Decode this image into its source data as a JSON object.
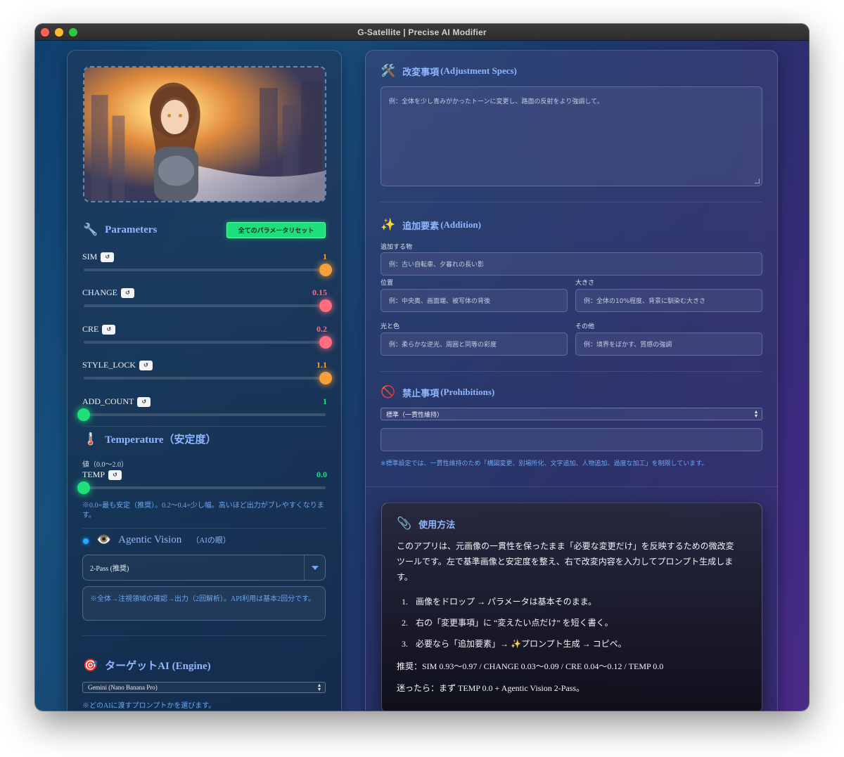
{
  "window": {
    "title": "G-Satellite | Precise AI Modifier"
  },
  "left": {
    "parameters": {
      "icon": "🔧",
      "title": "Parameters",
      "reset_all_label": "全てのパラメータリセット",
      "sliders": [
        {
          "name": "SIM",
          "value": "1",
          "fraction": 1.0,
          "color": "#f7a03a"
        },
        {
          "name": "CHANGE",
          "value": "0.15",
          "fraction": 1.0,
          "color": "#ff6b7f"
        },
        {
          "name": "CRE",
          "value": "0.2",
          "fraction": 1.0,
          "color": "#ff6b7f"
        },
        {
          "name": "STYLE_LOCK",
          "value": "1.1",
          "fraction": 1.0,
          "color": "#f7a03a"
        },
        {
          "name": "ADD_COUNT",
          "value": "1",
          "fraction": 0.0,
          "color": "#1ee07a"
        }
      ],
      "reset_glyph": "↺"
    },
    "temperature": {
      "icon": "🌡️",
      "title": "Temperature（安定度）",
      "range_label": "値（0.0〜2.0）",
      "slider": {
        "name": "TEMP",
        "value": "0.0",
        "fraction": 0.0,
        "color": "#1ee07a"
      },
      "note": "※0.0=最も安定（推奨）。0.2〜0.4=少し幅。高いほど出力がブレやすくなります。"
    },
    "agentic_vision": {
      "icon": "👁️",
      "title": "Agentic Vision",
      "subtitle": "（AIの眼）",
      "selected": "2-Pass (推奨)",
      "hint": "※全体→注視領域の確認→出力（2回解析）。API利用は基本2回分です。"
    },
    "target_ai": {
      "icon": "🎯",
      "title": "ターゲットAI (Engine)",
      "selected": "Gemini (Nano Banana Pro)",
      "note": "※どのAIに渡すプロンプトかを選びます。"
    }
  },
  "right": {
    "adjustment": {
      "icon": "🛠️",
      "title": "改変事項",
      "subtitle": "(Adjustment Specs)",
      "placeholder": "例：全体を少し青みがかったトーンに変更し、路面の反射をより強調して。"
    },
    "addition": {
      "icon": "✨",
      "title": "追加要素",
      "subtitle": "(Addition)",
      "item_label": "追加する物",
      "item_placeholder": "例：古い自転車、夕暮れの長い影",
      "position_label": "位置",
      "position_placeholder": "例：中央奥、画面端、被写体の背後",
      "size_label": "大きさ",
      "size_placeholder": "例：全体の10%程度、背景に馴染む大きさ",
      "light_label": "光と色",
      "light_placeholder": "例：柔らかな逆光、周囲と同等の彩度",
      "other_label": "その他",
      "other_placeholder": "例：境界をぼかす、質感の強調"
    },
    "prohibitions": {
      "icon": "🚫",
      "title": "禁止事項",
      "subtitle": "(Prohibitions)",
      "selected": "標準（一貫性維持）",
      "input_value": "",
      "note": "※標準設定では、一貫性維持のため「構図変更、別場所化、文字追加、人物追加、過度な加工」を制限しています。"
    },
    "usage": {
      "icon": "📎",
      "title": "使用方法",
      "intro_line1": "このアプリは、元画像の一貫性を保ったまま「必要な変更だけ」を反映するための微改変",
      "intro_line2": "ツールです。左で基準画像と安定度を整え、右で改変内容を入力してプロンプト生成しま",
      "intro_line3": "す。",
      "steps": [
        {
          "num": "1.",
          "text": "画像をドロップ → パラメータは基本そのまま。"
        },
        {
          "num": "2.",
          "text": "右の「変更事項」に “変えたい点だけ” を短く書く。"
        },
        {
          "num": "3.",
          "text": "必要なら「追加要素」→ ✨プロンプト生成 → コピペ。"
        }
      ],
      "recommend": "推奨：SIM 0.93〜0.97 / CHANGE 0.03〜0.09 / CRE 0.04〜0.12 / TEMP 0.0",
      "fallback": "迷ったら：まず TEMP 0.0 + Agentic Vision 2-Pass。"
    }
  },
  "colors": {
    "accent_blue": "#8fb6ff",
    "note_blue": "#6aa6f2",
    "green": "#1ee07a",
    "orange": "#f7a03a",
    "pink": "#ff6b7f"
  }
}
